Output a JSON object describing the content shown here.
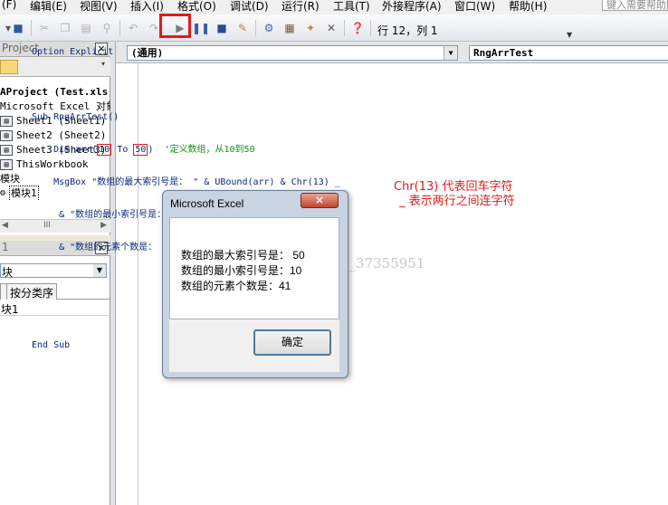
{
  "menu": {
    "items": [
      "(F)",
      "编辑(E)",
      "视图(V)",
      "插入(I)",
      "格式(O)",
      "调试(D)",
      "运行(R)",
      "工具(T)",
      "外接程序(A)",
      "窗口(W)",
      "帮助(H)"
    ],
    "help_placeholder": "键入需要帮助"
  },
  "toolbar": {
    "position_text": "行 12，列 1",
    "icons": [
      "dropdown-icon",
      "save-icon",
      "cut-icon",
      "copy-icon",
      "paste-icon",
      "find-icon",
      "undo-icon",
      "redo-icon",
      "run-icon",
      "break-icon",
      "reset-icon",
      "design-mode-icon",
      "project-explorer-icon",
      "properties-icon",
      "object-browser-icon",
      "toolbox-icon",
      "help-icon"
    ]
  },
  "project_panel": {
    "title": "Project",
    "close": "×",
    "tree": [
      {
        "label": "AProject (Test.xls",
        "bold": true
      },
      {
        "label": "Microsoft Excel 对象"
      },
      {
        "label": "Sheet1 (Sheet1)"
      },
      {
        "label": "Sheet2 (Sheet2)"
      },
      {
        "label": "Sheet3 (Sheet3)"
      },
      {
        "label": "ThisWorkbook"
      },
      {
        "label": "模块"
      },
      {
        "label": "模块1"
      }
    ],
    "scroll_grip": "III"
  },
  "properties_panel": {
    "title": "1",
    "close": "×",
    "combo_value": "块",
    "tabs": [
      "",
      "按分类序"
    ],
    "row": "块1"
  },
  "code_window": {
    "object_combo": "(通用)",
    "proc_combo": "RngArrTest",
    "lines": {
      "l1": "Option Explicit",
      "l2": "Sub RngArrTest()",
      "l3a": "    Dim arr(",
      "l3b": "10",
      "l3c": " To ",
      "l3d": "50",
      "l3e": ")  ",
      "l3f": "'定义数组，从10到50",
      "l4": "    MsgBox \"数组的最大索引号是： \" & UBound(arr) & Chr(13) _",
      "l5": "     & \"数组的最小索引号是： \" & LBound(arr) & Chr(13) _",
      "l6": "     & \"数组的元素个数是： \" & UBound(arr) - LBound(arr) + 1",
      "l7": "End Sub"
    },
    "annotation1": "Chr(13) 代表回车字符",
    "annotation2": "_ 表示两行之间连字符",
    "watermark": "csdn.net/m0_37355951"
  },
  "dialog": {
    "title": "Microsoft Excel",
    "close": "×",
    "line1": "数组的最大索引号是： 50",
    "line2": "数组的最小索引号是：10",
    "line3": "数组的元素个数是：41",
    "ok": "确定"
  }
}
